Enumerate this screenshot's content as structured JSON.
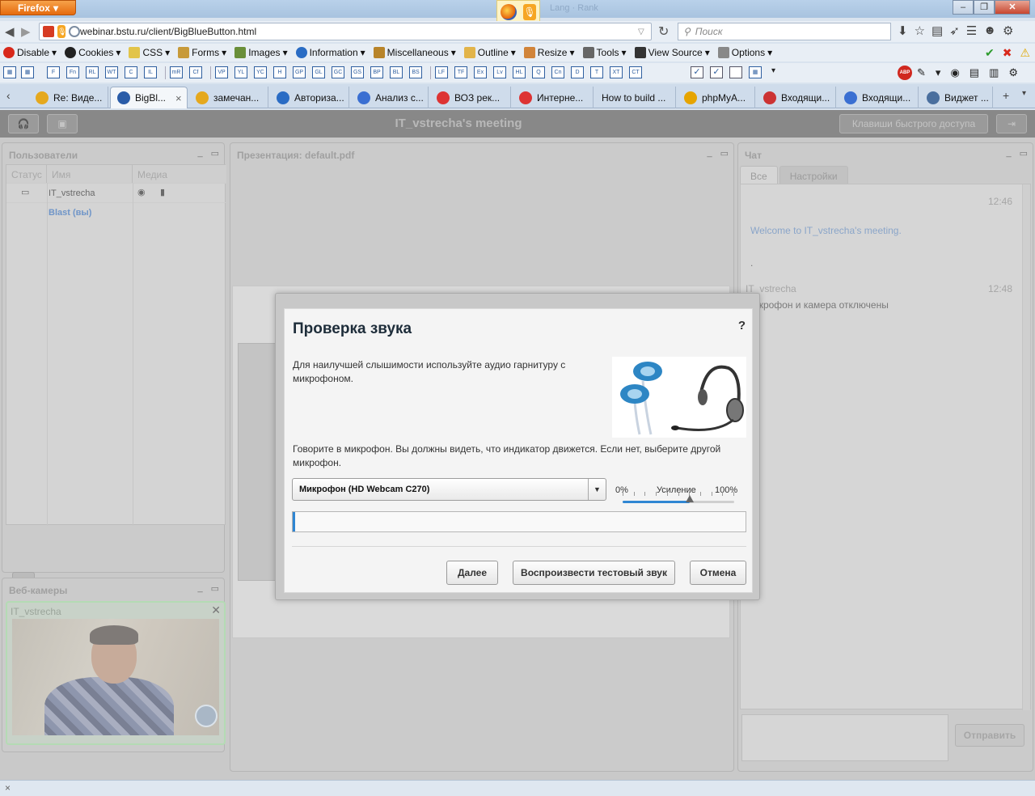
{
  "browser": {
    "app_button": "Firefox",
    "window_title_ghost": "Lang · Rank",
    "url": "webinar.bstu.ru/client/BigBlueButton.html",
    "search_placeholder": "Поиск",
    "webdev_items": [
      "Disable",
      "Cookies",
      "CSS",
      "Forms",
      "Images",
      "Information",
      "Miscellaneous",
      "Outline",
      "Resize",
      "Tools",
      "View Source",
      "Options"
    ],
    "toolbar_codes": [
      "F",
      "Fn",
      "RL",
      "WT",
      "C",
      "IL",
      "mR",
      "Cf",
      "VP",
      "YL",
      "YC",
      "H",
      "GP",
      "GL",
      "GC",
      "GS",
      "BP",
      "BL",
      "BS",
      "LF",
      "TF",
      "Ex",
      "Lv",
      "HL",
      "Q",
      "Cn",
      "D",
      "T",
      "XT",
      "CT"
    ],
    "tabs": [
      {
        "label": "Re: Виде...",
        "icon_color": "#e5a81d"
      },
      {
        "label": "BigBl...",
        "icon_color": "#2a5ca8",
        "active": true
      },
      {
        "label": "замечан...",
        "icon_color": "#e5a81d"
      },
      {
        "label": "Авториза...",
        "icon_color": "#2a6cc4"
      },
      {
        "label": "Анализ с...",
        "icon_color": "#3a6fd2"
      },
      {
        "label": "ВОЗ рек...",
        "icon_color": "#d33"
      },
      {
        "label": "Интерне...",
        "icon_color": "#d33"
      },
      {
        "label": "How to build ...",
        "icon_color": ""
      },
      {
        "label": "phpMyA...",
        "icon_color": "#e6a400"
      },
      {
        "label": "Входящи...",
        "icon_color": "#c33"
      },
      {
        "label": "Входящи...",
        "icon_color": "#3a6fd2"
      },
      {
        "label": "Виджет ...",
        "icon_color": "#4a6f9e"
      }
    ],
    "status_left": "×"
  },
  "app": {
    "meeting_title": "IT_vstrecha's meeting",
    "shortcuts_button": "Клавиши быстрого доступа",
    "users_panel": {
      "title": "Пользователи",
      "columns": [
        "Статус",
        "Имя",
        "Медиа"
      ],
      "rows": [
        {
          "name": "IT_vstrecha"
        },
        {
          "name": "Blast (вы)"
        }
      ]
    },
    "presentation_panel": {
      "title": "Презентация: default.pdf"
    },
    "webcams_panel": {
      "title": "Веб-камеры",
      "camera_name": "IT_vstrecha"
    },
    "chat_panel": {
      "title": "Чат",
      "tabs": [
        "Все",
        "Настройки"
      ],
      "messages": [
        {
          "time": "12:46",
          "text": "Welcome to IT_vstrecha's meeting."
        },
        {
          "text": "."
        },
        {
          "sender": "IT_vstrecha",
          "time": "12:48",
          "text": "Микрофон и камера отключены"
        }
      ],
      "send_label": "Отправить"
    }
  },
  "dialog": {
    "title": "Проверка звука",
    "help": "?",
    "intro": "Для наилучшей слышимости используйте аудио гарнитуру с микрофоном.",
    "instruction": "Говорите в микрофон. Вы должны видеть, что индикатор движется. Если нет, выберите другой микрофон.",
    "mic_selected": "Микрофон (HD Webcam C270)",
    "gain": {
      "min_label": "0%",
      "label": "Усиление",
      "max_label": "100%",
      "value": 0.6
    },
    "input_level": 0.005,
    "buttons": {
      "next": "Далее",
      "play_test": "Воспроизвести тестовый звук",
      "cancel": "Отмена"
    },
    "accent": "#2f86d3"
  }
}
